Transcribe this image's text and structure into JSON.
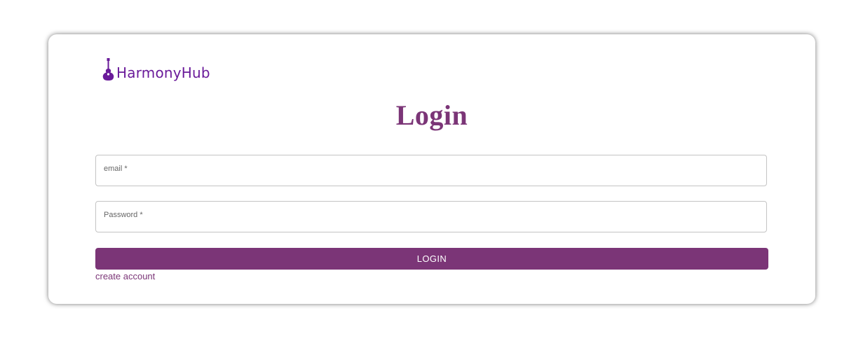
{
  "brand": {
    "logo_text": "HarmonyHub",
    "icon": "guitar-icon",
    "color": "#6a1b9a"
  },
  "page": {
    "title": "Login"
  },
  "form": {
    "email_label": "email *",
    "email_value": "",
    "password_label": "Password *",
    "password_value": "",
    "submit_label": "LOGIN",
    "create_account_label": "create account"
  },
  "colors": {
    "accent": "#7b3577",
    "field_border": "#c4c4c4",
    "label_text": "#666666"
  }
}
